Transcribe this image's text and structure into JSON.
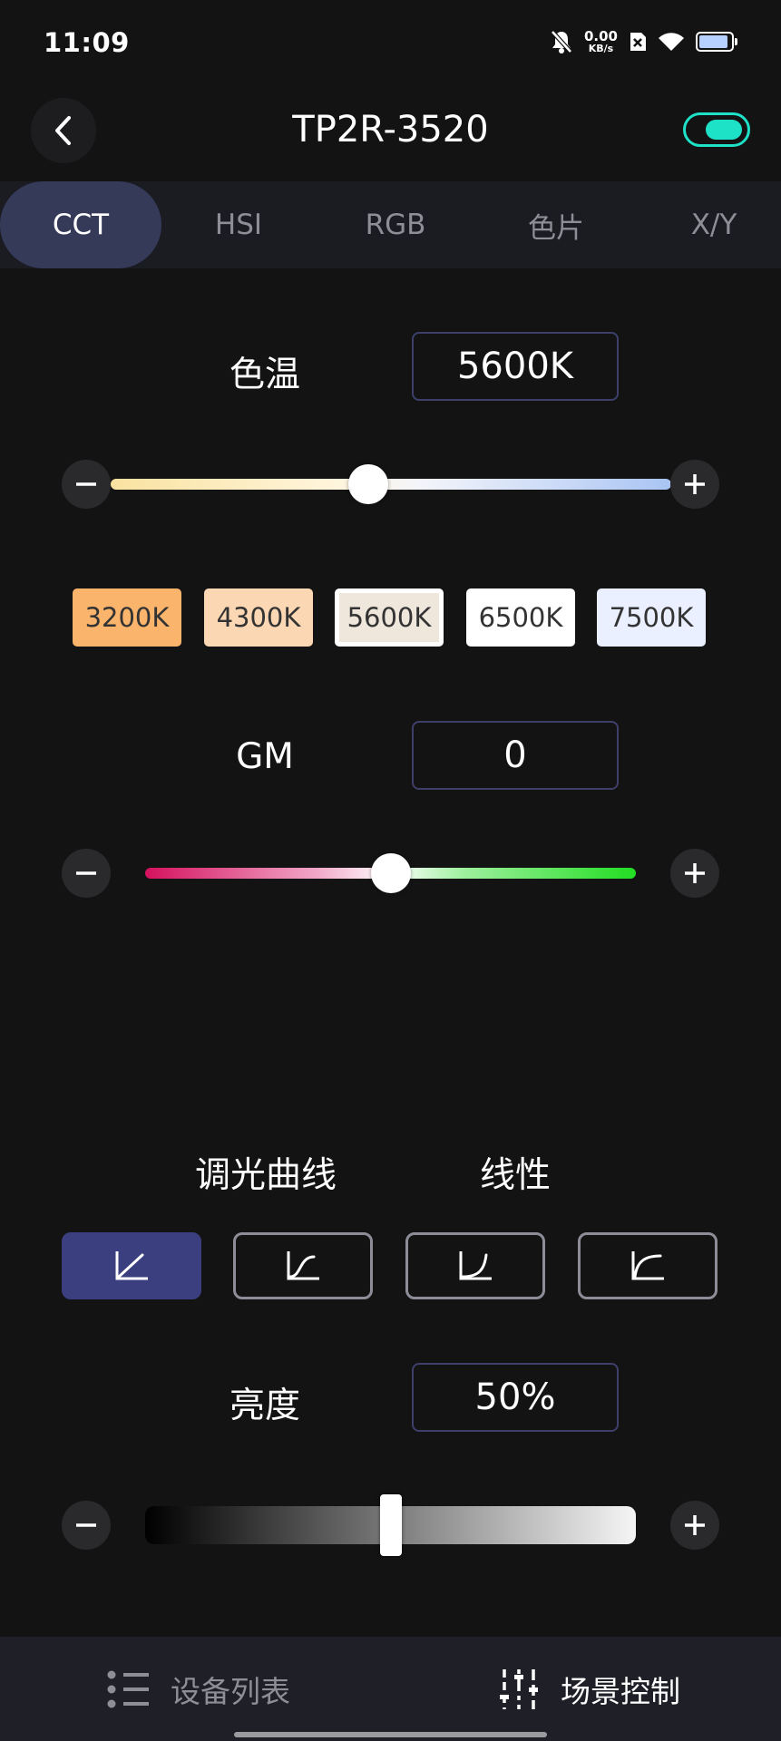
{
  "status_bar": {
    "time": "11:09",
    "net_speed_value": "0.00",
    "net_speed_unit": "KB/s",
    "battery_level": 0.9
  },
  "header": {
    "title": "TP2R-3520",
    "power_on": true
  },
  "tabs": [
    {
      "label": "CCT",
      "active": true
    },
    {
      "label": "HSI",
      "active": false
    },
    {
      "label": "RGB",
      "active": false
    },
    {
      "label": "色片",
      "active": false
    },
    {
      "label": "X/Y",
      "active": false
    }
  ],
  "cct": {
    "label": "色温",
    "value": "5600K",
    "level": 0.46,
    "presets": [
      "3200K",
      "4300K",
      "5600K",
      "6500K",
      "7500K"
    ],
    "selected_preset": "5600K",
    "preset_colors": [
      "#fbb46c",
      "#fcd7b4",
      "#efe6dc",
      "#ffffff",
      "#eaf0ff"
    ]
  },
  "gm": {
    "label": "GM",
    "value": "0",
    "level": 0.5
  },
  "curve": {
    "label": "调光曲线",
    "value": "线性",
    "options": [
      "linear",
      "s-curve",
      "exponential",
      "logarithmic"
    ],
    "selected": "linear"
  },
  "brightness": {
    "label": "亮度",
    "value": "50%",
    "level": 0.5
  },
  "bottom_nav": {
    "device_list": "设备列表",
    "scene_control": "场景控制"
  },
  "colors": {
    "accent": "#1de2c8",
    "tab_active": "#343a58",
    "curve_active": "#3b3f80"
  }
}
